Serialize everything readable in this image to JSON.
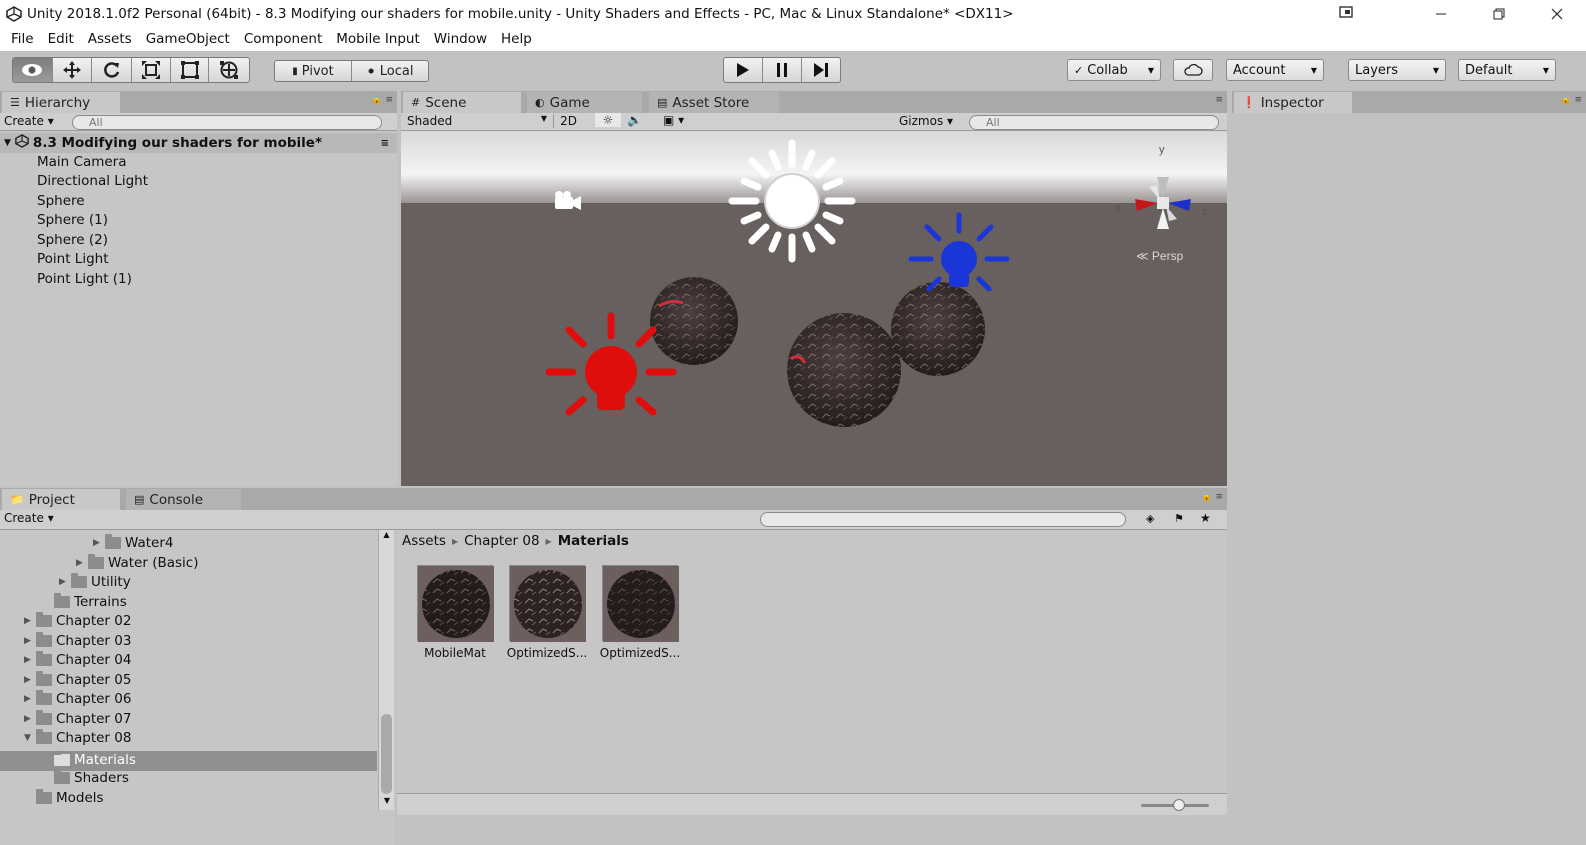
{
  "window": {
    "title": "Unity 2018.1.0f2 Personal (64bit) - 8.3 Modifying our shaders for mobile.unity - Unity Shaders and Effects - PC, Mac & Linux Standalone* <DX11>",
    "controls": [
      "minimize",
      "restore",
      "close"
    ]
  },
  "menu": [
    "File",
    "Edit",
    "Assets",
    "GameObject",
    "Component",
    "Mobile Input",
    "Window",
    "Help"
  ],
  "toolbar": {
    "tools": [
      "view-tool",
      "move-tool",
      "rotate-tool",
      "scale-tool",
      "rect-tool",
      "transform-tool"
    ],
    "pivot": "Pivot",
    "local": "Local",
    "collab": "Collab",
    "account": "Account",
    "layers": "Layers",
    "layout": "Default"
  },
  "hierarchy": {
    "tab": "Hierarchy",
    "create": "Create",
    "search_placeholder": "All",
    "scene_name": "8.3 Modifying our shaders for mobile*",
    "items": [
      "Main Camera",
      "Directional Light",
      "Sphere",
      "Sphere (1)",
      "Sphere (2)",
      "Point Light",
      "Point Light (1)"
    ]
  },
  "scene": {
    "tabs": [
      "Scene",
      "Game",
      "Asset Store"
    ],
    "shading_mode": "Shaded",
    "mode_2d": "2D",
    "gizmos": "Gizmos",
    "search_placeholder": "All",
    "persp_label": "Persp",
    "axis_x": "x",
    "axis_y": "y",
    "axis_z": "z",
    "colors": {
      "sky_top": "#e8e8e8",
      "ground": "#685f5f",
      "red_light": "#e00d0d",
      "blue_light": "#1a35d8"
    }
  },
  "inspector": {
    "tab": "Inspector"
  },
  "project": {
    "tabs": [
      "Project",
      "Console"
    ],
    "create": "Create",
    "tree": [
      {
        "label": "Water4",
        "indent": 3,
        "expandable": true
      },
      {
        "label": "Water (Basic)",
        "indent": 3,
        "expandable": true
      },
      {
        "label": "Utility",
        "indent": 2,
        "expandable": true
      },
      {
        "label": "Terrains",
        "indent": 1,
        "expandable": false
      },
      {
        "label": "Chapter 02",
        "indent": 0,
        "expandable": true
      },
      {
        "label": "Chapter 03",
        "indent": 0,
        "expandable": true
      },
      {
        "label": "Chapter 04",
        "indent": 0,
        "expandable": true
      },
      {
        "label": "Chapter 05",
        "indent": 0,
        "expandable": true
      },
      {
        "label": "Chapter 06",
        "indent": 0,
        "expandable": true
      },
      {
        "label": "Chapter 07",
        "indent": 0,
        "expandable": true
      },
      {
        "label": "Chapter 08",
        "indent": 0,
        "expandable": true,
        "expanded": true
      },
      {
        "label": "Materials",
        "indent": 1,
        "expandable": false,
        "selected": true
      },
      {
        "label": "Shaders",
        "indent": 1,
        "expandable": false
      },
      {
        "label": "Models",
        "indent": 0,
        "expandable": false
      }
    ],
    "breadcrumb": [
      "Assets",
      "Chapter 08",
      "Materials"
    ],
    "assets": [
      "MobileMat",
      "OptimizedS...",
      "OptimizedS..."
    ]
  }
}
